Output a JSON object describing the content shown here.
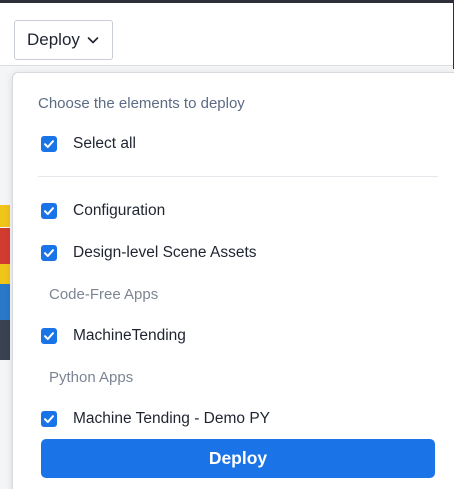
{
  "toolbar": {
    "deploy_trigger_label": "Deploy"
  },
  "panel": {
    "hint": "Choose the elements to deploy",
    "select_all": {
      "label": "Select all",
      "checked": true
    },
    "items": [
      {
        "label": "Configuration",
        "checked": true
      },
      {
        "label": "Design-level Scene Assets",
        "checked": true
      }
    ],
    "sections": [
      {
        "title": "Code-Free Apps",
        "items": [
          {
            "label": "MachineTending",
            "checked": true
          }
        ]
      },
      {
        "title": "Python Apps",
        "items": [
          {
            "label": "Machine Tending - Demo PY",
            "checked": true
          }
        ]
      }
    ],
    "deploy_button_label": "Deploy"
  },
  "colors": {
    "accent": "#1b73e8",
    "hint_text": "#5c6b85",
    "section_text": "#7d8593"
  },
  "icons": {
    "trigger_chevron": "chevron-down-icon",
    "checkbox_mark": "check-icon"
  }
}
